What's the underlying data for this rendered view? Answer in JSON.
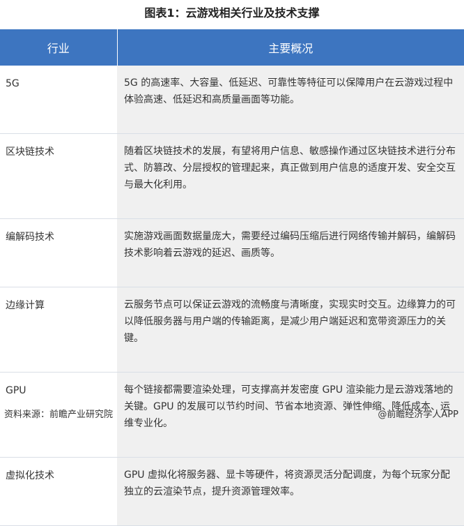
{
  "title": "图表1：云游戏相关行业及技术支撑",
  "table": {
    "headers": [
      "行业",
      "主要概况"
    ],
    "rows": [
      {
        "industry": "5G",
        "desc": "5G 的高速率、大容量、低延迟、可靠性等特征可以保障用户在云游戏过程中体验高速、低延迟和高质量画面等功能。"
      },
      {
        "industry": "区块链技术",
        "desc": "随着区块链技术的发展，有望将用户信息、敏感操作通过区块链技术进行分布式、防篡改、分层授权的管理起来，真正做到用户信息的适度开发、安全交互与最大化利用。"
      },
      {
        "industry": "编解码技术",
        "desc": "实施游戏画面数据量庞大，需要经过编码压缩后进行网络传输并解码，编解码技术影响着云游戏的延迟、画质等。"
      },
      {
        "industry": "边缘计算",
        "desc": "云服务节点可以保证云游戏的流畅度与清晰度，实现实时交互。边缘算力的可以降低服务器与用户端的传输距离，是减少用户端延迟和宽带资源压力的关键。"
      },
      {
        "industry": "GPU",
        "desc": "每个链接都需要渲染处理，可支撑高并发密度 GPU 渲染能力是云游戏落地的关键。GPU 的发展可以节约时间、节省本地资源、弹性伸缩、降低成本、运维专业化。"
      },
      {
        "industry": "虚拟化技术",
        "desc": "GPU 虚拟化将服务器、显卡等硬件，将资源灵活分配调度，为每个玩家分配独立的云渲染节点，提升资源管理效率。"
      }
    ]
  },
  "footer": {
    "source": "资料来源：前瞻产业研究院",
    "brand": "@前瞻经济学人APP"
  },
  "colors": {
    "header_bg": "#3d75c0",
    "desc_bg": "#f0f0f0"
  }
}
